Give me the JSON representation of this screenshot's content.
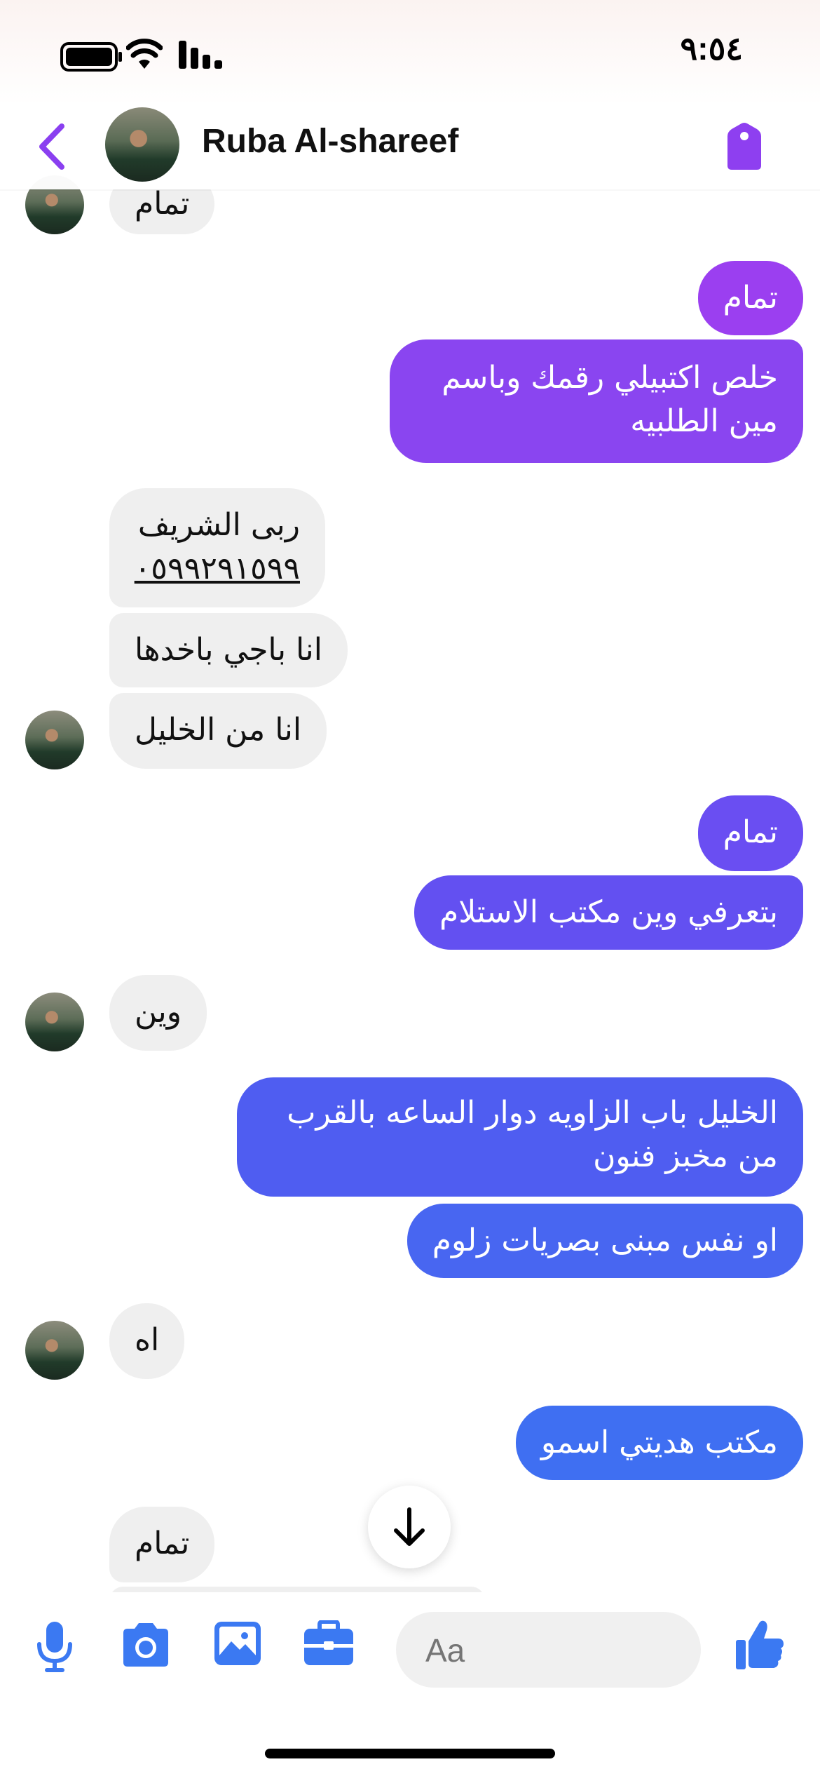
{
  "status_bar": {
    "time": "٩:٥٤"
  },
  "header": {
    "contact_name": "Ruba Al-shareef"
  },
  "messages": [
    {
      "text": "تمام",
      "side": "in"
    },
    {
      "text": "تمام",
      "side": "out",
      "color": "#9b3ff0"
    },
    {
      "text": "خلص اكتبيلي رقمك وباسم مين الطلبيه",
      "line1": "خلص اكتبيلي رقمك وباسم",
      "line2": "مين الطلبيه",
      "side": "out",
      "color": "#8a45f0"
    },
    {
      "text": "ربى الشريف ٠٥٩٩٢٩١٥٩٩",
      "line1": "ربى الشريف",
      "line2": "٠٥٩٩٢٩١٥٩٩",
      "side": "in"
    },
    {
      "text": "انا باجي باخدها",
      "side": "in"
    },
    {
      "text": "انا من الخليل",
      "side": "in"
    },
    {
      "text": "تمام",
      "side": "out",
      "color": "#6a4ef2"
    },
    {
      "text": "بتعرفي وين مكتب الاستلام",
      "side": "out",
      "color": "#6350f1"
    },
    {
      "text": "وين",
      "side": "in"
    },
    {
      "text": "الخليل باب الزاويه دوار الساعه بالقرب من مخبز فنون",
      "line1": "الخليل باب الزاويه دوار الساعه بالقرب",
      "line2": "من مخبز فنون",
      "side": "out",
      "color": "#4f5df1"
    },
    {
      "text": "او نفس مبنى بصريات زلوم",
      "side": "out",
      "color": "#4866f1"
    },
    {
      "text": "اه",
      "side": "in"
    },
    {
      "text": "مكتب هديتي اسمو",
      "side": "out",
      "color": "#3f6ff2"
    },
    {
      "text": "تمام",
      "side": "in"
    }
  ],
  "composer": {
    "placeholder": "Aa"
  },
  "colors": {
    "accent_purple": "#9b3ff0",
    "accent_blue": "#3f6ff2",
    "incoming_bubble": "#efefef"
  },
  "icons": [
    "back-chevron-icon",
    "tag-icon",
    "microphone-icon",
    "camera-icon",
    "gallery-icon",
    "briefcase-icon",
    "emoji-icon",
    "thumbs-up-icon",
    "arrow-down-icon",
    "battery-icon",
    "wifi-icon",
    "signal-icon"
  ]
}
